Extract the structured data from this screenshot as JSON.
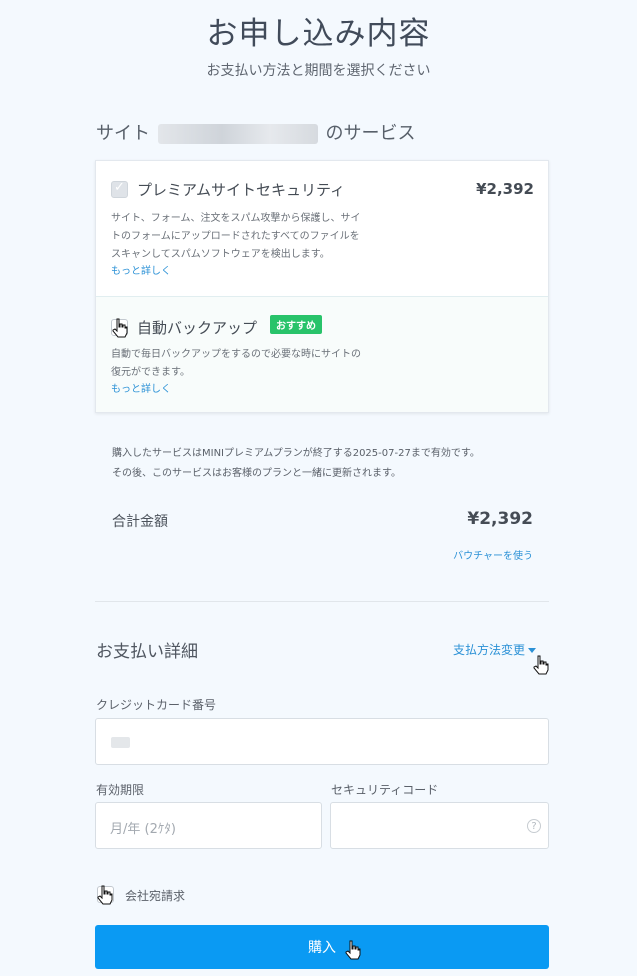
{
  "header": {
    "title": "お申し込み内容",
    "subtitle": "お支払い方法と期間を選択ください"
  },
  "services": {
    "heading_prefix": "サイト",
    "heading_suffix": "のサービス",
    "items": [
      {
        "title": "プレミアムサイトセキュリティ",
        "price": "¥2,392",
        "desc_lines": [
          "サイト、フォーム、注文をスパム攻撃から保護し、サイ",
          "トのフォームにアップロードされたすべてのファイルを",
          "スキャンしてスパムソフトウェアを検出します。"
        ],
        "learn_more": "もっと詳しく",
        "checked": true
      },
      {
        "title": "自動バックアップ",
        "badge": "おすすめ",
        "desc_lines": [
          "自動で毎日バックアップをするので必要な時にサイトの",
          "復元ができます。"
        ],
        "learn_more": "もっと詳しく",
        "checked": false
      }
    ]
  },
  "notes": {
    "line1": "購入したサービスはMINIプレミアムプランが終了する2025-07-27まで有効です。",
    "line2": "その後、このサービスはお客様のプランと一緒に更新されます。"
  },
  "total": {
    "label": "合計金額",
    "value": "¥2,392",
    "voucher_link": "バウチャーを使う"
  },
  "payment": {
    "heading": "お支払い詳細",
    "change_method": "支払方法変更",
    "card_number_label": "クレジットカード番号",
    "expiry_label": "有効期限",
    "expiry_placeholder": "月/年 (2ｹﾀ)",
    "security_code_label": "セキュリティコード",
    "help_glyph": "?",
    "invoice_label": "会社宛請求",
    "buy_button": "購入"
  },
  "colors": {
    "accent": "#0a9af3",
    "link": "#2b91d6",
    "badge": "#28c36a",
    "background": "#f4f9fe"
  },
  "icons": [
    "checkbox-checked-icon",
    "checkbox-icon",
    "credit-card-icon",
    "help-circle-icon",
    "caret-down-icon",
    "hand-pointer-icon"
  ]
}
